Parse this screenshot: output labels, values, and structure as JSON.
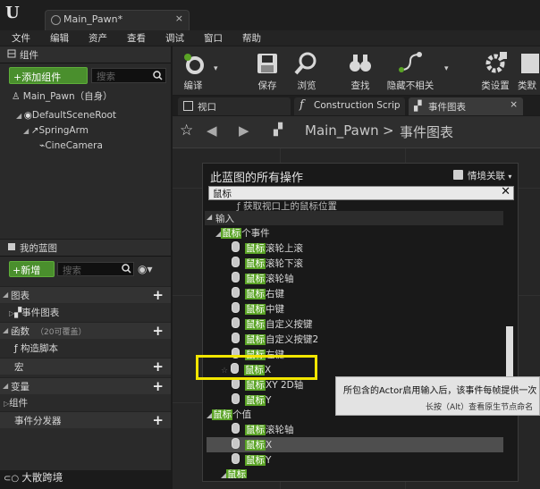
{
  "window": {
    "tab_title": "Main_Pawn*",
    "close_glyph": "×"
  },
  "menu": [
    "文件",
    "编辑",
    "资产",
    "查看",
    "调试",
    "窗口",
    "帮助"
  ],
  "components": {
    "title": "组件",
    "add_button": "+添加组件",
    "search_placeholder": "搜索",
    "self_item": "Main_Pawn（自身）",
    "tree": [
      "DefaultSceneRoot",
      "SpringArm",
      "CineCamera"
    ]
  },
  "my_blueprint": {
    "title": "我的蓝图",
    "new_button": "+新增",
    "search_placeholder": "搜索",
    "categories": {
      "graphs": "图表",
      "event_graph": "事件图表",
      "functions": "函数",
      "functions_note": "（20可覆盖）",
      "construction_script": "构造脚本",
      "macros": "宏",
      "variables": "变量",
      "components": "组件",
      "event_dispatchers": "事件分发器"
    }
  },
  "toolbar": {
    "compile": "编译",
    "save": "保存",
    "browse": "浏览",
    "find": "查找",
    "hide_unrelated": "隐藏不相关",
    "class_settings": "类设置",
    "class_defaults": "类默"
  },
  "editor_tabs": [
    "视口",
    "Construction Scrip",
    "事件图表"
  ],
  "breadcrumb": {
    "root": "Main_Pawn",
    "separator": ">",
    "current": "事件图表"
  },
  "context_menu": {
    "title": "此蓝图的所有操作",
    "context_sensitive": "情境关联",
    "search_value": "鼠标",
    "partial_item": "获取视口上的鼠标位置",
    "input_section": "输入",
    "mouse_events_group": "鼠标个事件",
    "mouse_prefix": "鼠标",
    "events": [
      "滚轮上滚",
      "滚轮下滚",
      "滚轮轴",
      "右键",
      "中键",
      "自定义按键",
      "自定义按键2",
      "左键",
      "X",
      "XY 2D轴",
      "Y"
    ],
    "mouse_values_group": "鼠标个值",
    "values": [
      "滚轮轴",
      "X",
      "Y"
    ],
    "cut_item": "鼠标"
  },
  "tooltip": {
    "line1": "所包含的Actor启用输入后，该事件每帧提供一次",
    "line2": "长按（Alt）查看原生节点命名"
  },
  "watermark": "大散跨境",
  "colors": {
    "highlight": "#5aa325",
    "annotation": "#f2e600",
    "accent_green": "#4a8f2d"
  }
}
